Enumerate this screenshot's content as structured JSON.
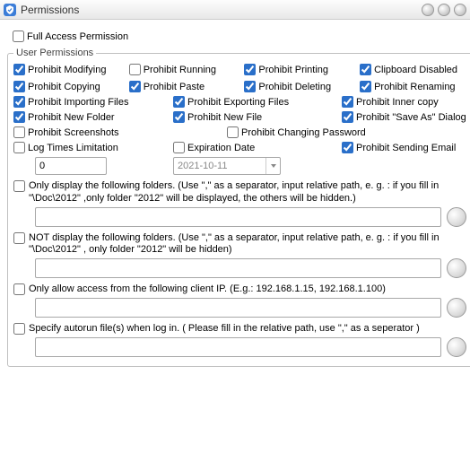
{
  "window": {
    "title": "Permissions"
  },
  "fullAccess": {
    "label": "Full Access Permission",
    "checked": false
  },
  "fieldset": {
    "legend": "User Permissions"
  },
  "perm": [
    {
      "label": "Prohibit Modifying",
      "checked": true
    },
    {
      "label": "Prohibit Running",
      "checked": false
    },
    {
      "label": "Prohibit Printing",
      "checked": true
    },
    {
      "label": "Clipboard Disabled",
      "checked": true
    },
    {
      "label": "Prohibit Copying",
      "checked": true
    },
    {
      "label": "Prohibit Paste",
      "checked": true
    },
    {
      "label": "Prohibit Deleting",
      "checked": true
    },
    {
      "label": "Prohibit Renaming",
      "checked": true
    },
    {
      "label": "Prohibit Importing Files",
      "checked": true
    },
    {
      "label": "Prohibit Exporting Files",
      "checked": true
    },
    {
      "label": "Prohibit Inner copy",
      "checked": true
    }
  ],
  "perm3": [
    {
      "label": "Prohibit New Folder",
      "checked": true
    },
    {
      "label": "Prohibit New File",
      "checked": true
    },
    {
      "label": "Prohibit \"Save As\" Dialog",
      "checked": true
    }
  ],
  "row5": {
    "screenshots": {
      "label": "Prohibit Screenshots",
      "checked": false
    },
    "password": {
      "label": "Prohibit Changing Password",
      "checked": false
    }
  },
  "row6": {
    "log": {
      "label": "Log Times Limitation",
      "checked": false
    },
    "exp": {
      "label": "Expiration Date",
      "checked": false
    },
    "email": {
      "label": "Prohibit Sending Email",
      "checked": true
    }
  },
  "row7": {
    "logValue": "0",
    "dateValue": "2021-10-11"
  },
  "sections": [
    {
      "checked": false,
      "text": "Only display the following folders. (Use \",\" as a separator, input relative path,  e. g. : if you fill in \"\\Doc\\2012\" ,only folder \"2012\" will be displayed, the others will be hidden.)",
      "value": ""
    },
    {
      "checked": false,
      "text": "NOT display the following folders. (Use \",\" as a separator, input relative path,  e. g. : if you fill in \"\\Doc\\2012\" , only folder \"2012\" will be hidden)",
      "value": ""
    },
    {
      "checked": false,
      "text": "Only allow access from the following client IP. (E.g.: 192.168.1.15, 192.168.1.100)",
      "value": ""
    },
    {
      "checked": false,
      "text": "Specify autorun file(s) when log in. ( Please fill in the relative path, use \",\" as a seperator )",
      "value": ""
    }
  ]
}
